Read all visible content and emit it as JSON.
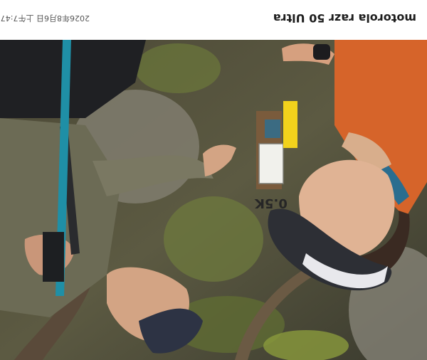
{
  "watermark": {
    "brand": "motorola razr 50 Ultra",
    "timestamp": "2026年8月6日 上午7:47"
  },
  "photo": {
    "orientation": "upside-down",
    "scene": "two hikers smiling beside a trail marker post in a forest",
    "trail_marker": "0.5K",
    "colors": {
      "forest_dark": "#3f3c2e",
      "leaf_green": "#6e7a3e",
      "rock_grey": "#8f8c80",
      "sleeve_olive": "#6c6b55",
      "jacket_orange": "#d6642a",
      "pole_teal": "#1f8fa6",
      "cap_navy": "#2d3344",
      "skin": "#d3a484",
      "marker_yellow": "#f2d21c"
    }
  }
}
